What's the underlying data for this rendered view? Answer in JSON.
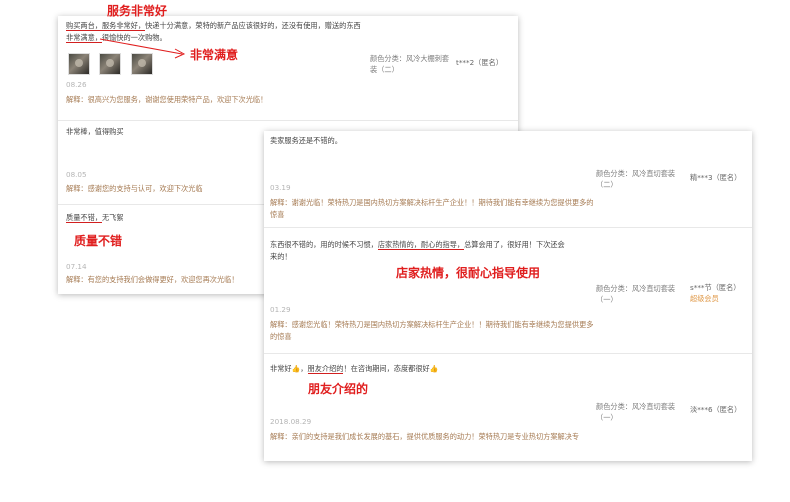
{
  "annotations": {
    "service": "服务非常好",
    "satisfied": "非常满意",
    "quality": "质量不错",
    "guidance": "店家热情，很耐心指导使用",
    "referral": "朋友介绍的"
  },
  "back_panel": {
    "review1": {
      "text_a": "购买两台，服务非常好，",
      "text_b": "快递十分满意，荣特的新产品应该很好的，还没有使用，赠送的东西",
      "text_c": "非常满意，",
      "text_d": "很愉快的一次购物。",
      "variant": "颜色分类：风冷大棚刺套装（二）",
      "user": "t***2（匿名）",
      "date": "08.26",
      "reply": "解释：很高兴为您服务，谢谢您使用荣特产品，欢迎下次光临！"
    },
    "review2": {
      "text": "非常棒，值得购买",
      "date": "08.05",
      "reply": "解释：感谢您的支持与认可，欢迎下次光临"
    },
    "review3": {
      "text_a": "质量不错，",
      "text_b": "无飞絮",
      "date": "07.14",
      "reply": "解释：有您的支持我们会做得更好，欢迎您再次光临！"
    }
  },
  "front_panel": {
    "review1": {
      "text": "卖家服务还是不错的。",
      "variant": "颜色分类：风冷直切套装（二）",
      "user": "精***3（匿名）",
      "date": "03.19",
      "reply": "解释：谢谢光临！荣特热刀是国内热切方案解决标杆生产企业！！期待我们能有幸继续为您提供更多的惊喜"
    },
    "review2": {
      "text_a": "东西很不错的，用的时候不习惯，",
      "text_b": "店家热情的，耐心的指导，",
      "text_c": "总算会用了，很好用！下次还会来的！",
      "variant": "颜色分类：风冷直切套装（一）",
      "user": "s***节（匿名）",
      "member": "超级会员",
      "date": "01.29",
      "reply": "解释：感谢您光临！荣特热刀是国内热切方案解决标杆生产企业！！期待我们能有幸继续为您提供更多的惊喜"
    },
    "review3": {
      "text_a": "非常好",
      "emoji": "👍",
      "text_b": "朋友介绍的",
      "text_c": "！在咨询期间，态度都很好",
      "date": "2018.08.29",
      "variant": "颜色分类：风冷直切套装（一）",
      "user": "淡***6（匿名）",
      "reply": "解释：亲们的支持是我们成长发展的基石，提供优质服务的动力！荣特热刀是专业热切方案解决专"
    }
  }
}
